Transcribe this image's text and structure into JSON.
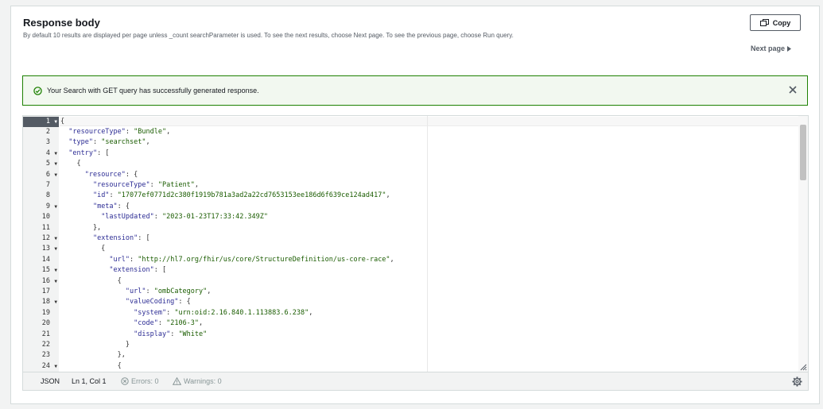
{
  "header": {
    "title": "Response body",
    "description": "By default 10 results are displayed per page unless _count searchParameter is used. To see the next results, choose Next page. To see the previous page, choose Run query.",
    "copy_label": "Copy",
    "next_page_label": "Next page"
  },
  "alert": {
    "message": "Your Search with GET query has successfully generated response.",
    "icon": "check-circle-icon",
    "status_color": "#1d8102"
  },
  "editor": {
    "lines": [
      {
        "n": "1",
        "fold": true,
        "t": [
          [
            "p",
            "{"
          ]
        ]
      },
      {
        "n": "2",
        "fold": false,
        "t": [
          [
            "p",
            "  "
          ],
          [
            "k",
            "\"resourceType\""
          ],
          [
            "p",
            ": "
          ],
          [
            "s",
            "\"Bundle\""
          ],
          [
            "p",
            ","
          ]
        ]
      },
      {
        "n": "3",
        "fold": false,
        "t": [
          [
            "p",
            "  "
          ],
          [
            "k",
            "\"type\""
          ],
          [
            "p",
            ": "
          ],
          [
            "s",
            "\"searchset\""
          ],
          [
            "p",
            ","
          ]
        ]
      },
      {
        "n": "4",
        "fold": true,
        "t": [
          [
            "p",
            "  "
          ],
          [
            "k",
            "\"entry\""
          ],
          [
            "p",
            ": ["
          ]
        ]
      },
      {
        "n": "5",
        "fold": true,
        "t": [
          [
            "p",
            "    {"
          ]
        ]
      },
      {
        "n": "6",
        "fold": true,
        "t": [
          [
            "p",
            "      "
          ],
          [
            "k",
            "\"resource\""
          ],
          [
            "p",
            ": {"
          ]
        ]
      },
      {
        "n": "7",
        "fold": false,
        "t": [
          [
            "p",
            "        "
          ],
          [
            "k",
            "\"resourceType\""
          ],
          [
            "p",
            ": "
          ],
          [
            "s",
            "\"Patient\""
          ],
          [
            "p",
            ","
          ]
        ]
      },
      {
        "n": "8",
        "fold": false,
        "t": [
          [
            "p",
            "        "
          ],
          [
            "k",
            "\"id\""
          ],
          [
            "p",
            ": "
          ],
          [
            "s",
            "\"17077ef0771d2c380f1919b781a3ad2a22cd7653153ee186d6f639ce124ad417\""
          ],
          [
            "p",
            ","
          ]
        ]
      },
      {
        "n": "9",
        "fold": true,
        "t": [
          [
            "p",
            "        "
          ],
          [
            "k",
            "\"meta\""
          ],
          [
            "p",
            ": {"
          ]
        ]
      },
      {
        "n": "10",
        "fold": false,
        "t": [
          [
            "p",
            "          "
          ],
          [
            "k",
            "\"lastUpdated\""
          ],
          [
            "p",
            ": "
          ],
          [
            "s",
            "\"2023-01-23T17:33:42.349Z\""
          ]
        ]
      },
      {
        "n": "11",
        "fold": false,
        "t": [
          [
            "p",
            "        },"
          ]
        ]
      },
      {
        "n": "12",
        "fold": true,
        "t": [
          [
            "p",
            "        "
          ],
          [
            "k",
            "\"extension\""
          ],
          [
            "p",
            ": ["
          ]
        ]
      },
      {
        "n": "13",
        "fold": true,
        "t": [
          [
            "p",
            "          {"
          ]
        ]
      },
      {
        "n": "14",
        "fold": false,
        "t": [
          [
            "p",
            "            "
          ],
          [
            "k",
            "\"url\""
          ],
          [
            "p",
            ": "
          ],
          [
            "s",
            "\"http://hl7.org/fhir/us/core/StructureDefinition/us-core-race\""
          ],
          [
            "p",
            ","
          ]
        ]
      },
      {
        "n": "15",
        "fold": true,
        "t": [
          [
            "p",
            "            "
          ],
          [
            "k",
            "\"extension\""
          ],
          [
            "p",
            ": ["
          ]
        ]
      },
      {
        "n": "16",
        "fold": true,
        "t": [
          [
            "p",
            "              {"
          ]
        ]
      },
      {
        "n": "17",
        "fold": false,
        "t": [
          [
            "p",
            "                "
          ],
          [
            "k",
            "\"url\""
          ],
          [
            "p",
            ": "
          ],
          [
            "s",
            "\"ombCategory\""
          ],
          [
            "p",
            ","
          ]
        ]
      },
      {
        "n": "18",
        "fold": true,
        "t": [
          [
            "p",
            "                "
          ],
          [
            "k",
            "\"valueCoding\""
          ],
          [
            "p",
            ": {"
          ]
        ]
      },
      {
        "n": "19",
        "fold": false,
        "t": [
          [
            "p",
            "                  "
          ],
          [
            "k",
            "\"system\""
          ],
          [
            "p",
            ": "
          ],
          [
            "s",
            "\"urn:oid:2.16.840.1.113883.6.238\""
          ],
          [
            "p",
            ","
          ]
        ]
      },
      {
        "n": "20",
        "fold": false,
        "t": [
          [
            "p",
            "                  "
          ],
          [
            "k",
            "\"code\""
          ],
          [
            "p",
            ": "
          ],
          [
            "s",
            "\"2106-3\""
          ],
          [
            "p",
            ","
          ]
        ]
      },
      {
        "n": "21",
        "fold": false,
        "t": [
          [
            "p",
            "                  "
          ],
          [
            "k",
            "\"display\""
          ],
          [
            "p",
            ": "
          ],
          [
            "s",
            "\"White\""
          ]
        ]
      },
      {
        "n": "22",
        "fold": false,
        "t": [
          [
            "p",
            "                }"
          ]
        ]
      },
      {
        "n": "23",
        "fold": false,
        "t": [
          [
            "p",
            "              },"
          ]
        ]
      },
      {
        "n": "24",
        "fold": true,
        "t": [
          [
            "p",
            "              {"
          ]
        ]
      }
    ],
    "colors": {
      "key": "#2c2c94",
      "string": "#1a5c00",
      "punct": "#333333"
    }
  },
  "status": {
    "language": "JSON",
    "cursor": "Ln 1, Col 1",
    "errors": "Errors: 0",
    "warnings": "Warnings: 0",
    "settings_icon": "gear-icon"
  }
}
